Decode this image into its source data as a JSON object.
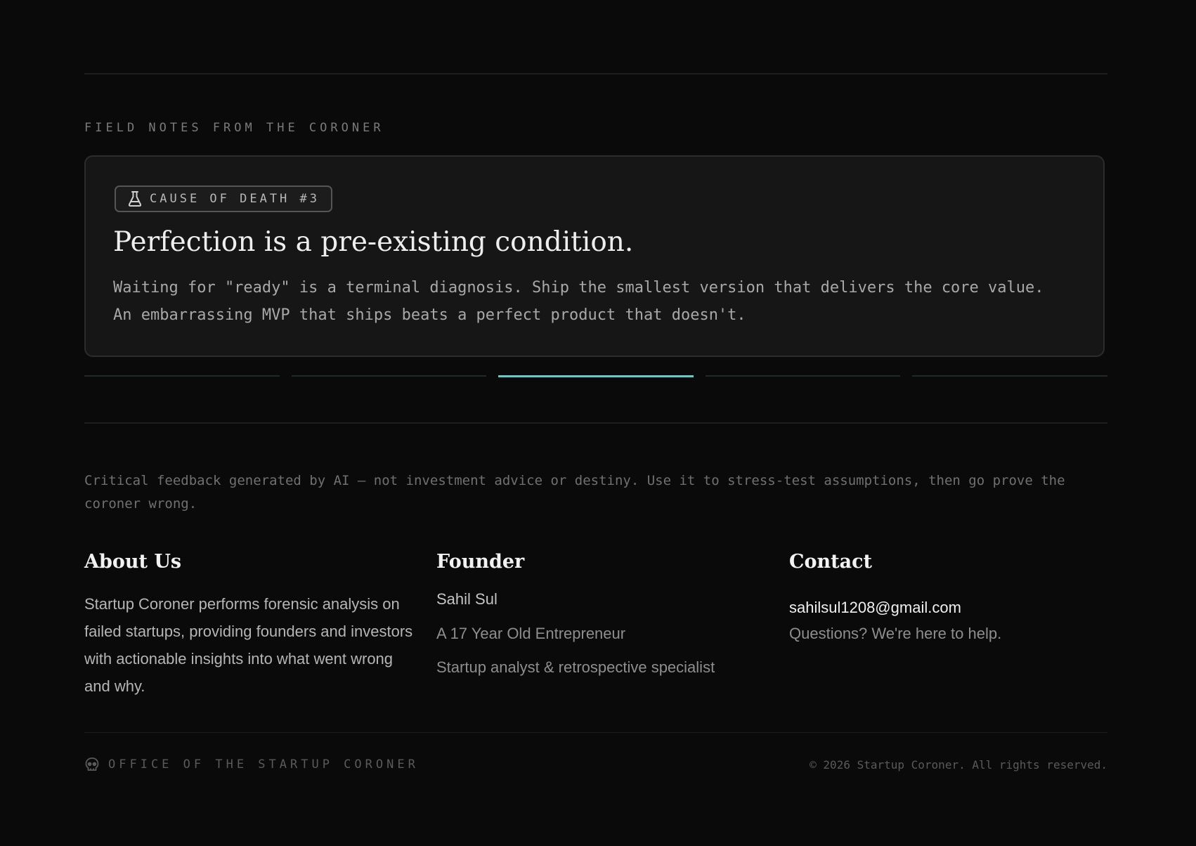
{
  "section": {
    "eyebrow": "FIELD NOTES FROM THE CORONER"
  },
  "card": {
    "badge_icon": "flask-icon",
    "badge": "CAUSE OF DEATH #3",
    "title": "Perfection is a pre-existing condition.",
    "body": "Waiting for \"ready\" is a terminal diagnosis. Ship the smallest version that delivers the core value. An embarrassing MVP that ships beats a perfect product that doesn't."
  },
  "carousel": {
    "total": 5,
    "active_index": 2,
    "active_color": "#6fc6c6"
  },
  "disclaimer": "Critical feedback generated by AI — not investment advice or destiny. Use it to stress-test assumptions, then go prove the coroner wrong.",
  "footer": {
    "about": {
      "heading": "About Us",
      "text": "Startup Coroner performs forensic analysis on failed startups, providing founders and investors with actionable insights into what went wrong and why."
    },
    "founder": {
      "heading": "Founder",
      "name": "Sahil Sul",
      "role": "A 17 Year Old Entrepreneur",
      "description": "Startup analyst & retrospective specialist"
    },
    "contact": {
      "heading": "Contact",
      "email": "sahilsul1208@gmail.com",
      "help": "Questions? We're here to help."
    },
    "bottom": {
      "icon": "skull-icon",
      "office": "OFFICE OF THE STARTUP CORONER",
      "copyright": "© 2026 Startup Coroner. All rights reserved."
    }
  }
}
